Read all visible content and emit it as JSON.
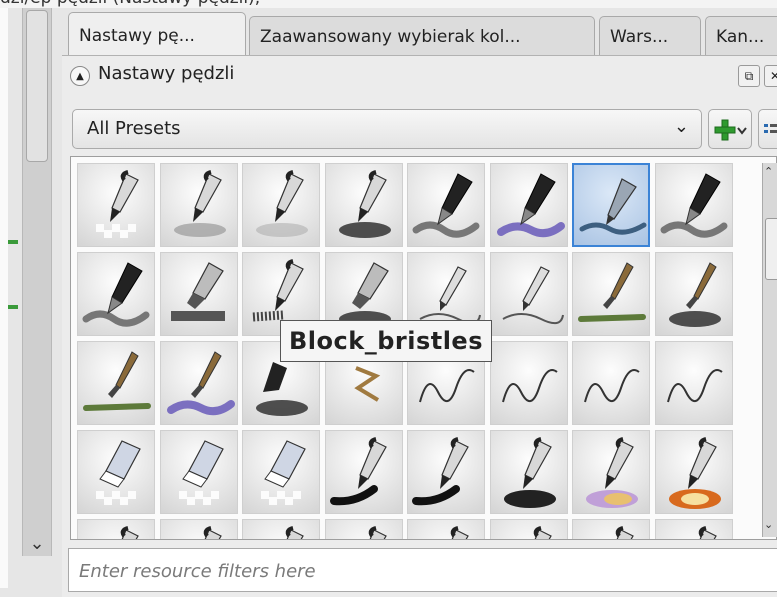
{
  "top_text": "dzi/ep pędzli (Nastawy pędzli),",
  "tabs": [
    {
      "label": "Nastawy pę...",
      "active": true
    },
    {
      "label": "Zaawansowany wybierak kol...",
      "active": false
    },
    {
      "label": "Wars...",
      "active": false
    },
    {
      "label": "Kan...",
      "active": false
    }
  ],
  "panel": {
    "title": "Nastawy pędzli",
    "combo_value": "All Presets",
    "filter_placeholder": "Enter resource filters here"
  },
  "tooltip": "Block_bristles",
  "presets": [
    {
      "style": "pen",
      "bg": "checker"
    },
    {
      "style": "pen",
      "bg": "gray"
    },
    {
      "style": "pen",
      "bg": "soft"
    },
    {
      "style": "pen",
      "bg": "dark"
    },
    {
      "style": "marker",
      "bg": "stroke"
    },
    {
      "style": "marker",
      "bg": "purple"
    },
    {
      "style": "pen-blue",
      "bg": "selected"
    },
    {
      "style": "marker",
      "bg": "stroke"
    },
    {
      "style": "marker",
      "bg": "stroke"
    },
    {
      "style": "chisel",
      "bg": "bar"
    },
    {
      "style": "pen",
      "bg": "bristle"
    },
    {
      "style": "chisel",
      "bg": "dark"
    },
    {
      "style": "pencil",
      "bg": "thin"
    },
    {
      "style": "pencil",
      "bg": "thin"
    },
    {
      "style": "brush",
      "bg": "green"
    },
    {
      "style": "brush",
      "bg": "dark"
    },
    {
      "style": "brush",
      "bg": "green"
    },
    {
      "style": "brush",
      "bg": "purple"
    },
    {
      "style": "blob",
      "bg": "dark"
    },
    {
      "style": "zigzag",
      "bg": "none"
    },
    {
      "style": "scribble",
      "bg": "none"
    },
    {
      "style": "scribble",
      "bg": "none"
    },
    {
      "style": "scribble",
      "bg": "none"
    },
    {
      "style": "scribble",
      "bg": "none"
    },
    {
      "style": "eraser",
      "bg": "checker"
    },
    {
      "style": "eraser",
      "bg": "checker"
    },
    {
      "style": "eraser",
      "bg": "checker"
    },
    {
      "style": "pen",
      "bg": "ink"
    },
    {
      "style": "pen",
      "bg": "ink"
    },
    {
      "style": "pen",
      "bg": "oval"
    },
    {
      "style": "pen",
      "bg": "rainbow"
    },
    {
      "style": "pen",
      "bg": "glow"
    },
    {
      "style": "pen",
      "bg": "none"
    },
    {
      "style": "pen",
      "bg": "none"
    },
    {
      "style": "pen",
      "bg": "none"
    },
    {
      "style": "pen",
      "bg": "none"
    },
    {
      "style": "pen",
      "bg": "none"
    },
    {
      "style": "pen",
      "bg": "none"
    },
    {
      "style": "pen",
      "bg": "none"
    },
    {
      "style": "pen",
      "bg": "none"
    }
  ],
  "colors": {
    "selection": "#3b83d6",
    "accent_green": "#3a9a3a"
  }
}
